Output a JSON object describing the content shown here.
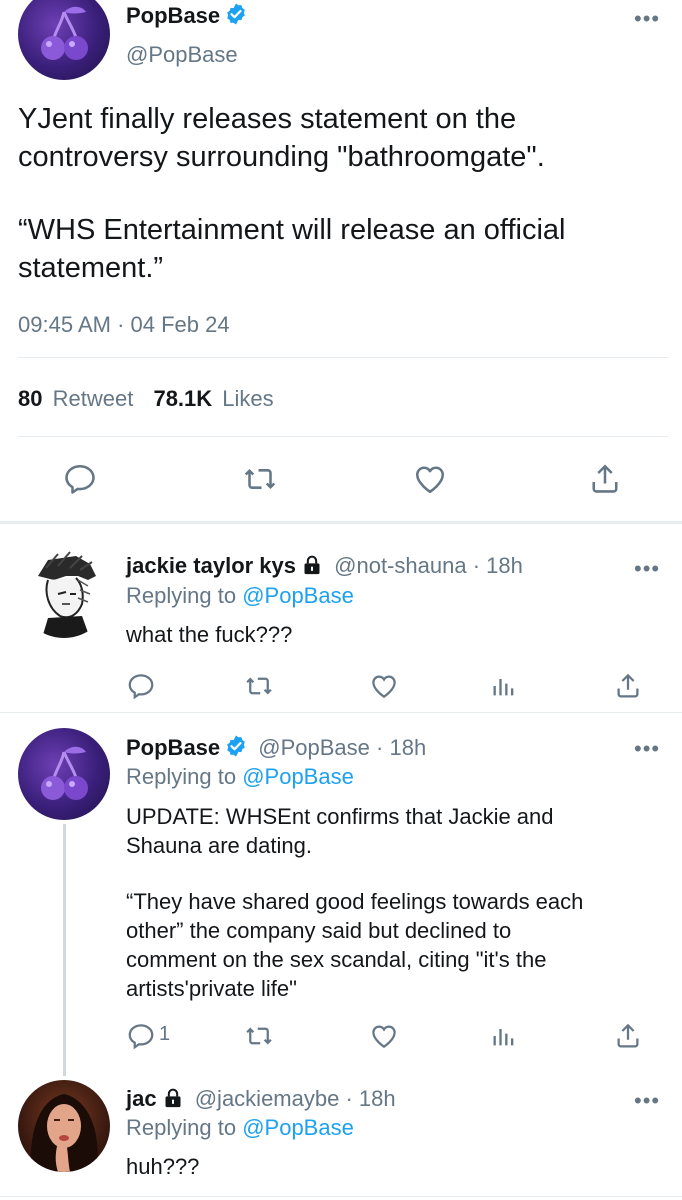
{
  "main_tweet": {
    "display_name": "PopBase",
    "handle": "@PopBase",
    "text_line1": "YJent finally releases statement on the",
    "text_line2": "controversy surrounding \"bathroomgate\".",
    "text_line3": "“WHS Entertainment will release an official",
    "text_line4": "statement.”",
    "timestamp": "09:45 AM · 04 Feb 24",
    "retweet_count": "80",
    "retweet_label": "Retweet",
    "likes_count": "78.1K",
    "likes_label": "Likes"
  },
  "replies": [
    {
      "display_name": "jackie taylor kys",
      "handle": "@not-shauna",
      "time": "· 18h",
      "replying_prefix": "Replying to",
      "replying_to": "@PopBase",
      "text": "what the fuck???",
      "reply_count": ""
    },
    {
      "display_name": "PopBase",
      "handle": "@PopBase",
      "time": "· 18h",
      "replying_prefix": "Replying to",
      "replying_to": "@PopBase",
      "text_line1": "UPDATE: WHSEnt confirms that Jackie and",
      "text_line2": "Shauna are dating.",
      "text_line3": "“They have shared good feelings towards each",
      "text_line4": "other” the company said but declined to",
      "text_line5": "comment on the sex scandal, citing \"it's the",
      "text_line6": "artists'private life\"",
      "reply_count": "1"
    },
    {
      "display_name": "jac",
      "handle": "@jackiemaybe",
      "time": "· 18h",
      "replying_prefix": "Replying to",
      "replying_to": "@PopBase",
      "text": "huh???"
    }
  ],
  "icons": {
    "more": "more-dots-icon",
    "reply": "reply-bubble-icon",
    "retweet": "retweet-icon",
    "like": "heart-icon",
    "share": "share-icon",
    "analytics": "analytics-icon",
    "verified": "verified-badge-icon",
    "lock": "lock-icon"
  },
  "colors": {
    "accent": "#1da1f2",
    "secondary_text": "#657786",
    "primary_text": "#14171a",
    "divider": "#e6ecf0"
  },
  "more_glyph": "•••"
}
